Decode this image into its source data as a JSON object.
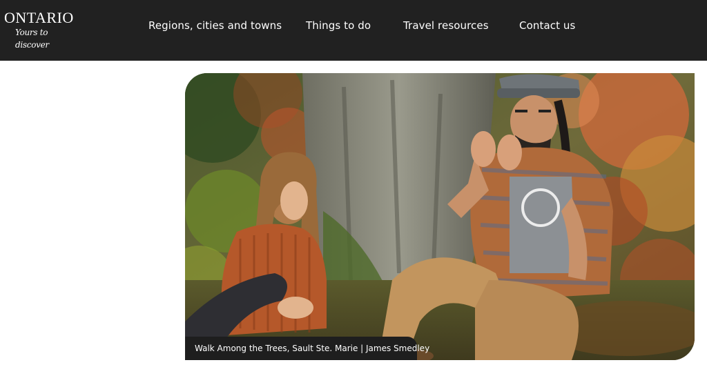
{
  "header": {
    "logo": {
      "wordmark": "ONTARIO",
      "tagline": "Yours to discover"
    },
    "nav": [
      {
        "label": "Regions, cities and towns"
      },
      {
        "label": "Things to do"
      },
      {
        "label": "Travel resources"
      },
      {
        "label": "Contact us"
      }
    ]
  },
  "hero": {
    "caption": "Walk Among the Trees, Sault Ste. Marie | James Smedley"
  },
  "colors": {
    "header_bg": "#212121",
    "page_bg": "#ffffff",
    "caption_bg": "#1e1e1e",
    "text_on_dark": "#ffffff"
  }
}
